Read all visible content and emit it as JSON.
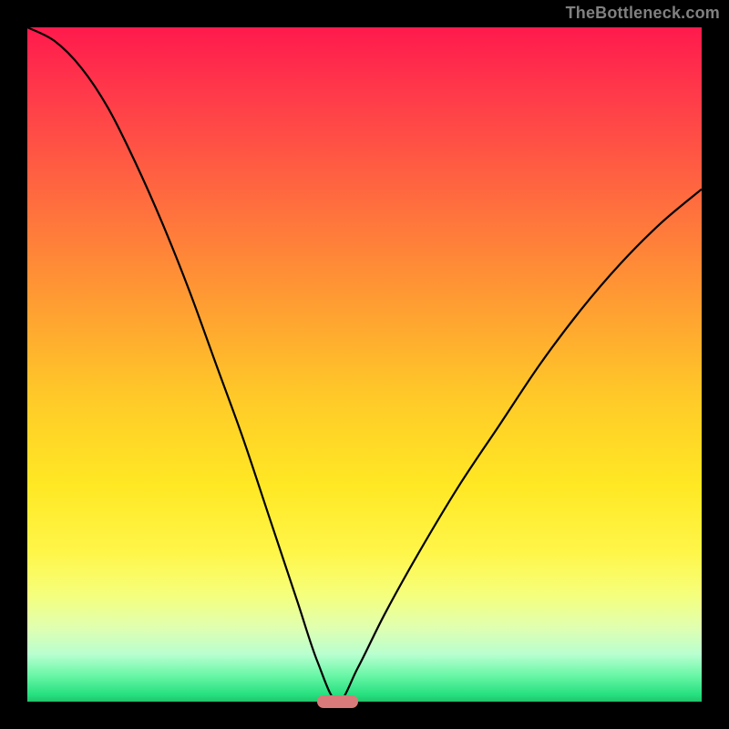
{
  "watermark": "TheBottleneck.com",
  "colors": {
    "black": "#000000",
    "curve": "#000000",
    "marker": "#d97a7a",
    "gradient_top": "#ff1a4d",
    "gradient_bottom": "#21c46a"
  },
  "chart_data": {
    "type": "line",
    "title": "",
    "xlabel": "",
    "ylabel": "",
    "xlim": [
      0,
      100
    ],
    "ylim": [
      0,
      100
    ],
    "optimal_x": 46,
    "optimal_y": 0,
    "marker": {
      "x": 46,
      "y": 0,
      "width": 6,
      "height": 2
    },
    "series": [
      {
        "name": "bottleneck-curve",
        "x": [
          0,
          4,
          8,
          12,
          16,
          20,
          24,
          28,
          32,
          36,
          40,
          43,
          46,
          49,
          53,
          58,
          64,
          70,
          76,
          82,
          88,
          94,
          100
        ],
        "values": [
          100,
          98,
          94,
          88,
          80,
          71,
          61,
          50,
          39,
          27,
          15,
          6,
          0,
          5,
          13,
          22,
          32,
          41,
          50,
          58,
          65,
          71,
          76
        ]
      }
    ],
    "annotations": []
  }
}
